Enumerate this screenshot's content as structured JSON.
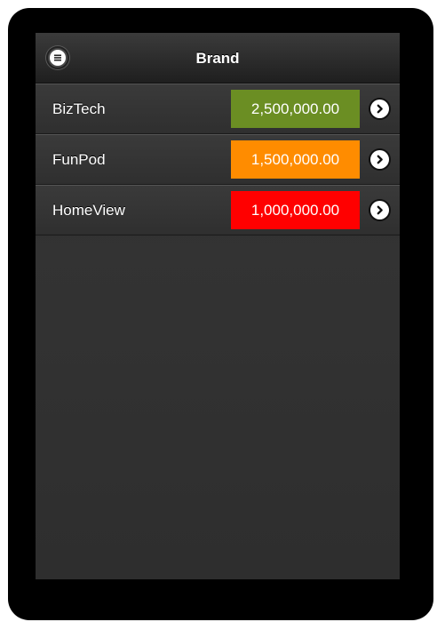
{
  "header": {
    "title": "Brand",
    "menu_icon": "menu-icon"
  },
  "list": {
    "items": [
      {
        "name": "BizTech",
        "value": "2,500,000.00",
        "color": "#6b8e23",
        "arrow_icon": "chevron-right-icon"
      },
      {
        "name": "FunPod",
        "value": "1,500,000.00",
        "color": "#ff8c00",
        "arrow_icon": "chevron-right-icon"
      },
      {
        "name": "HomeView",
        "value": "1,000,000.00",
        "color": "#ff0000",
        "arrow_icon": "chevron-right-icon"
      }
    ]
  }
}
